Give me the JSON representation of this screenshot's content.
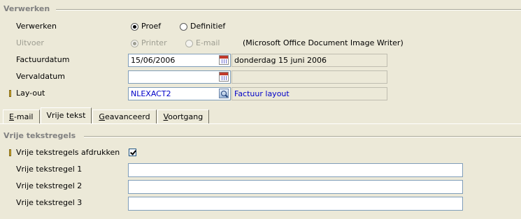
{
  "sections": {
    "verwerken_title": "Verwerken",
    "vrije_tekstregels_title": "Vrije tekstregels"
  },
  "verwerken": {
    "label": "Verwerken",
    "options": [
      {
        "label": "Proef",
        "checked": true
      },
      {
        "label": "Definitief",
        "checked": false
      }
    ]
  },
  "uitvoer": {
    "label": "Uitvoer",
    "options": [
      {
        "label": "Printer",
        "checked": true
      },
      {
        "label": "E-mail",
        "checked": false
      }
    ],
    "printer_name": "(Microsoft Office Document Image Writer)"
  },
  "factuurdatum": {
    "label": "Factuurdatum",
    "value": "15/06/2006",
    "description": "donderdag 15 juni 2006"
  },
  "vervaldatum": {
    "label": "Vervaldatum",
    "value": "",
    "description": ""
  },
  "layout": {
    "label": "Lay-out",
    "value": "NLEXACT2",
    "description": "Factuur layout"
  },
  "tabs": [
    {
      "label_pre": "",
      "label_ul": "E",
      "label_post": "-mail",
      "active": false
    },
    {
      "label_pre": "Vrije tekst",
      "label_ul": "",
      "label_post": "",
      "active": true
    },
    {
      "label_pre": "",
      "label_ul": "G",
      "label_post": "eavanceerd",
      "active": false
    },
    {
      "label_pre": "",
      "label_ul": "V",
      "label_post": "oortgang",
      "active": false
    }
  ],
  "vrije_tekst": {
    "afdrukken_label": "Vrije tekstregels afdrukken",
    "afdrukken_checked": true,
    "lines": [
      {
        "label": "Vrije tekstregel 1",
        "value": ""
      },
      {
        "label": "Vrije tekstregel 2",
        "value": ""
      },
      {
        "label": "Vrije tekstregel 3",
        "value": ""
      }
    ]
  },
  "colors": {
    "background": "#ece9d8",
    "link_blue": "#0000c8",
    "section_title": "#808080"
  }
}
